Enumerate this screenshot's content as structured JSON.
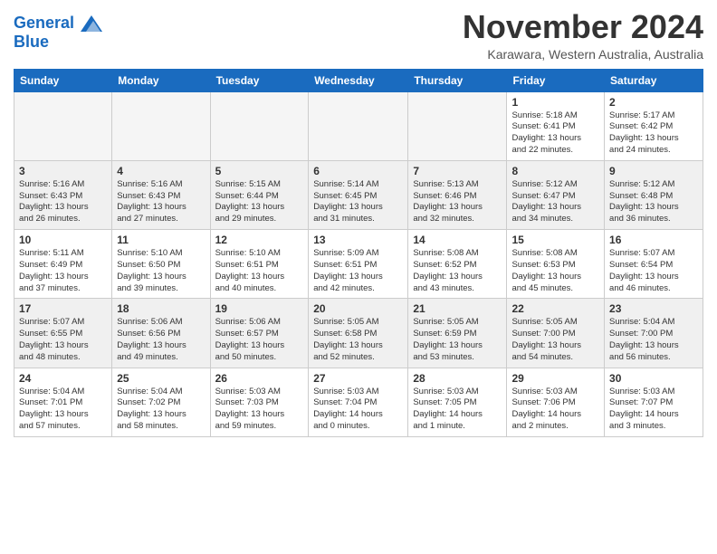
{
  "header": {
    "logo_line1": "General",
    "logo_line2": "Blue",
    "month": "November 2024",
    "location": "Karawara, Western Australia, Australia"
  },
  "weekdays": [
    "Sunday",
    "Monday",
    "Tuesday",
    "Wednesday",
    "Thursday",
    "Friday",
    "Saturday"
  ],
  "weeks": [
    [
      {
        "day": "",
        "info": ""
      },
      {
        "day": "",
        "info": ""
      },
      {
        "day": "",
        "info": ""
      },
      {
        "day": "",
        "info": ""
      },
      {
        "day": "",
        "info": ""
      },
      {
        "day": "1",
        "info": "Sunrise: 5:18 AM\nSunset: 6:41 PM\nDaylight: 13 hours\nand 22 minutes."
      },
      {
        "day": "2",
        "info": "Sunrise: 5:17 AM\nSunset: 6:42 PM\nDaylight: 13 hours\nand 24 minutes."
      }
    ],
    [
      {
        "day": "3",
        "info": "Sunrise: 5:16 AM\nSunset: 6:43 PM\nDaylight: 13 hours\nand 26 minutes."
      },
      {
        "day": "4",
        "info": "Sunrise: 5:16 AM\nSunset: 6:43 PM\nDaylight: 13 hours\nand 27 minutes."
      },
      {
        "day": "5",
        "info": "Sunrise: 5:15 AM\nSunset: 6:44 PM\nDaylight: 13 hours\nand 29 minutes."
      },
      {
        "day": "6",
        "info": "Sunrise: 5:14 AM\nSunset: 6:45 PM\nDaylight: 13 hours\nand 31 minutes."
      },
      {
        "day": "7",
        "info": "Sunrise: 5:13 AM\nSunset: 6:46 PM\nDaylight: 13 hours\nand 32 minutes."
      },
      {
        "day": "8",
        "info": "Sunrise: 5:12 AM\nSunset: 6:47 PM\nDaylight: 13 hours\nand 34 minutes."
      },
      {
        "day": "9",
        "info": "Sunrise: 5:12 AM\nSunset: 6:48 PM\nDaylight: 13 hours\nand 36 minutes."
      }
    ],
    [
      {
        "day": "10",
        "info": "Sunrise: 5:11 AM\nSunset: 6:49 PM\nDaylight: 13 hours\nand 37 minutes."
      },
      {
        "day": "11",
        "info": "Sunrise: 5:10 AM\nSunset: 6:50 PM\nDaylight: 13 hours\nand 39 minutes."
      },
      {
        "day": "12",
        "info": "Sunrise: 5:10 AM\nSunset: 6:51 PM\nDaylight: 13 hours\nand 40 minutes."
      },
      {
        "day": "13",
        "info": "Sunrise: 5:09 AM\nSunset: 6:51 PM\nDaylight: 13 hours\nand 42 minutes."
      },
      {
        "day": "14",
        "info": "Sunrise: 5:08 AM\nSunset: 6:52 PM\nDaylight: 13 hours\nand 43 minutes."
      },
      {
        "day": "15",
        "info": "Sunrise: 5:08 AM\nSunset: 6:53 PM\nDaylight: 13 hours\nand 45 minutes."
      },
      {
        "day": "16",
        "info": "Sunrise: 5:07 AM\nSunset: 6:54 PM\nDaylight: 13 hours\nand 46 minutes."
      }
    ],
    [
      {
        "day": "17",
        "info": "Sunrise: 5:07 AM\nSunset: 6:55 PM\nDaylight: 13 hours\nand 48 minutes."
      },
      {
        "day": "18",
        "info": "Sunrise: 5:06 AM\nSunset: 6:56 PM\nDaylight: 13 hours\nand 49 minutes."
      },
      {
        "day": "19",
        "info": "Sunrise: 5:06 AM\nSunset: 6:57 PM\nDaylight: 13 hours\nand 50 minutes."
      },
      {
        "day": "20",
        "info": "Sunrise: 5:05 AM\nSunset: 6:58 PM\nDaylight: 13 hours\nand 52 minutes."
      },
      {
        "day": "21",
        "info": "Sunrise: 5:05 AM\nSunset: 6:59 PM\nDaylight: 13 hours\nand 53 minutes."
      },
      {
        "day": "22",
        "info": "Sunrise: 5:05 AM\nSunset: 7:00 PM\nDaylight: 13 hours\nand 54 minutes."
      },
      {
        "day": "23",
        "info": "Sunrise: 5:04 AM\nSunset: 7:00 PM\nDaylight: 13 hours\nand 56 minutes."
      }
    ],
    [
      {
        "day": "24",
        "info": "Sunrise: 5:04 AM\nSunset: 7:01 PM\nDaylight: 13 hours\nand 57 minutes."
      },
      {
        "day": "25",
        "info": "Sunrise: 5:04 AM\nSunset: 7:02 PM\nDaylight: 13 hours\nand 58 minutes."
      },
      {
        "day": "26",
        "info": "Sunrise: 5:03 AM\nSunset: 7:03 PM\nDaylight: 13 hours\nand 59 minutes."
      },
      {
        "day": "27",
        "info": "Sunrise: 5:03 AM\nSunset: 7:04 PM\nDaylight: 14 hours\nand 0 minutes."
      },
      {
        "day": "28",
        "info": "Sunrise: 5:03 AM\nSunset: 7:05 PM\nDaylight: 14 hours\nand 1 minute."
      },
      {
        "day": "29",
        "info": "Sunrise: 5:03 AM\nSunset: 7:06 PM\nDaylight: 14 hours\nand 2 minutes."
      },
      {
        "day": "30",
        "info": "Sunrise: 5:03 AM\nSunset: 7:07 PM\nDaylight: 14 hours\nand 3 minutes."
      }
    ]
  ]
}
